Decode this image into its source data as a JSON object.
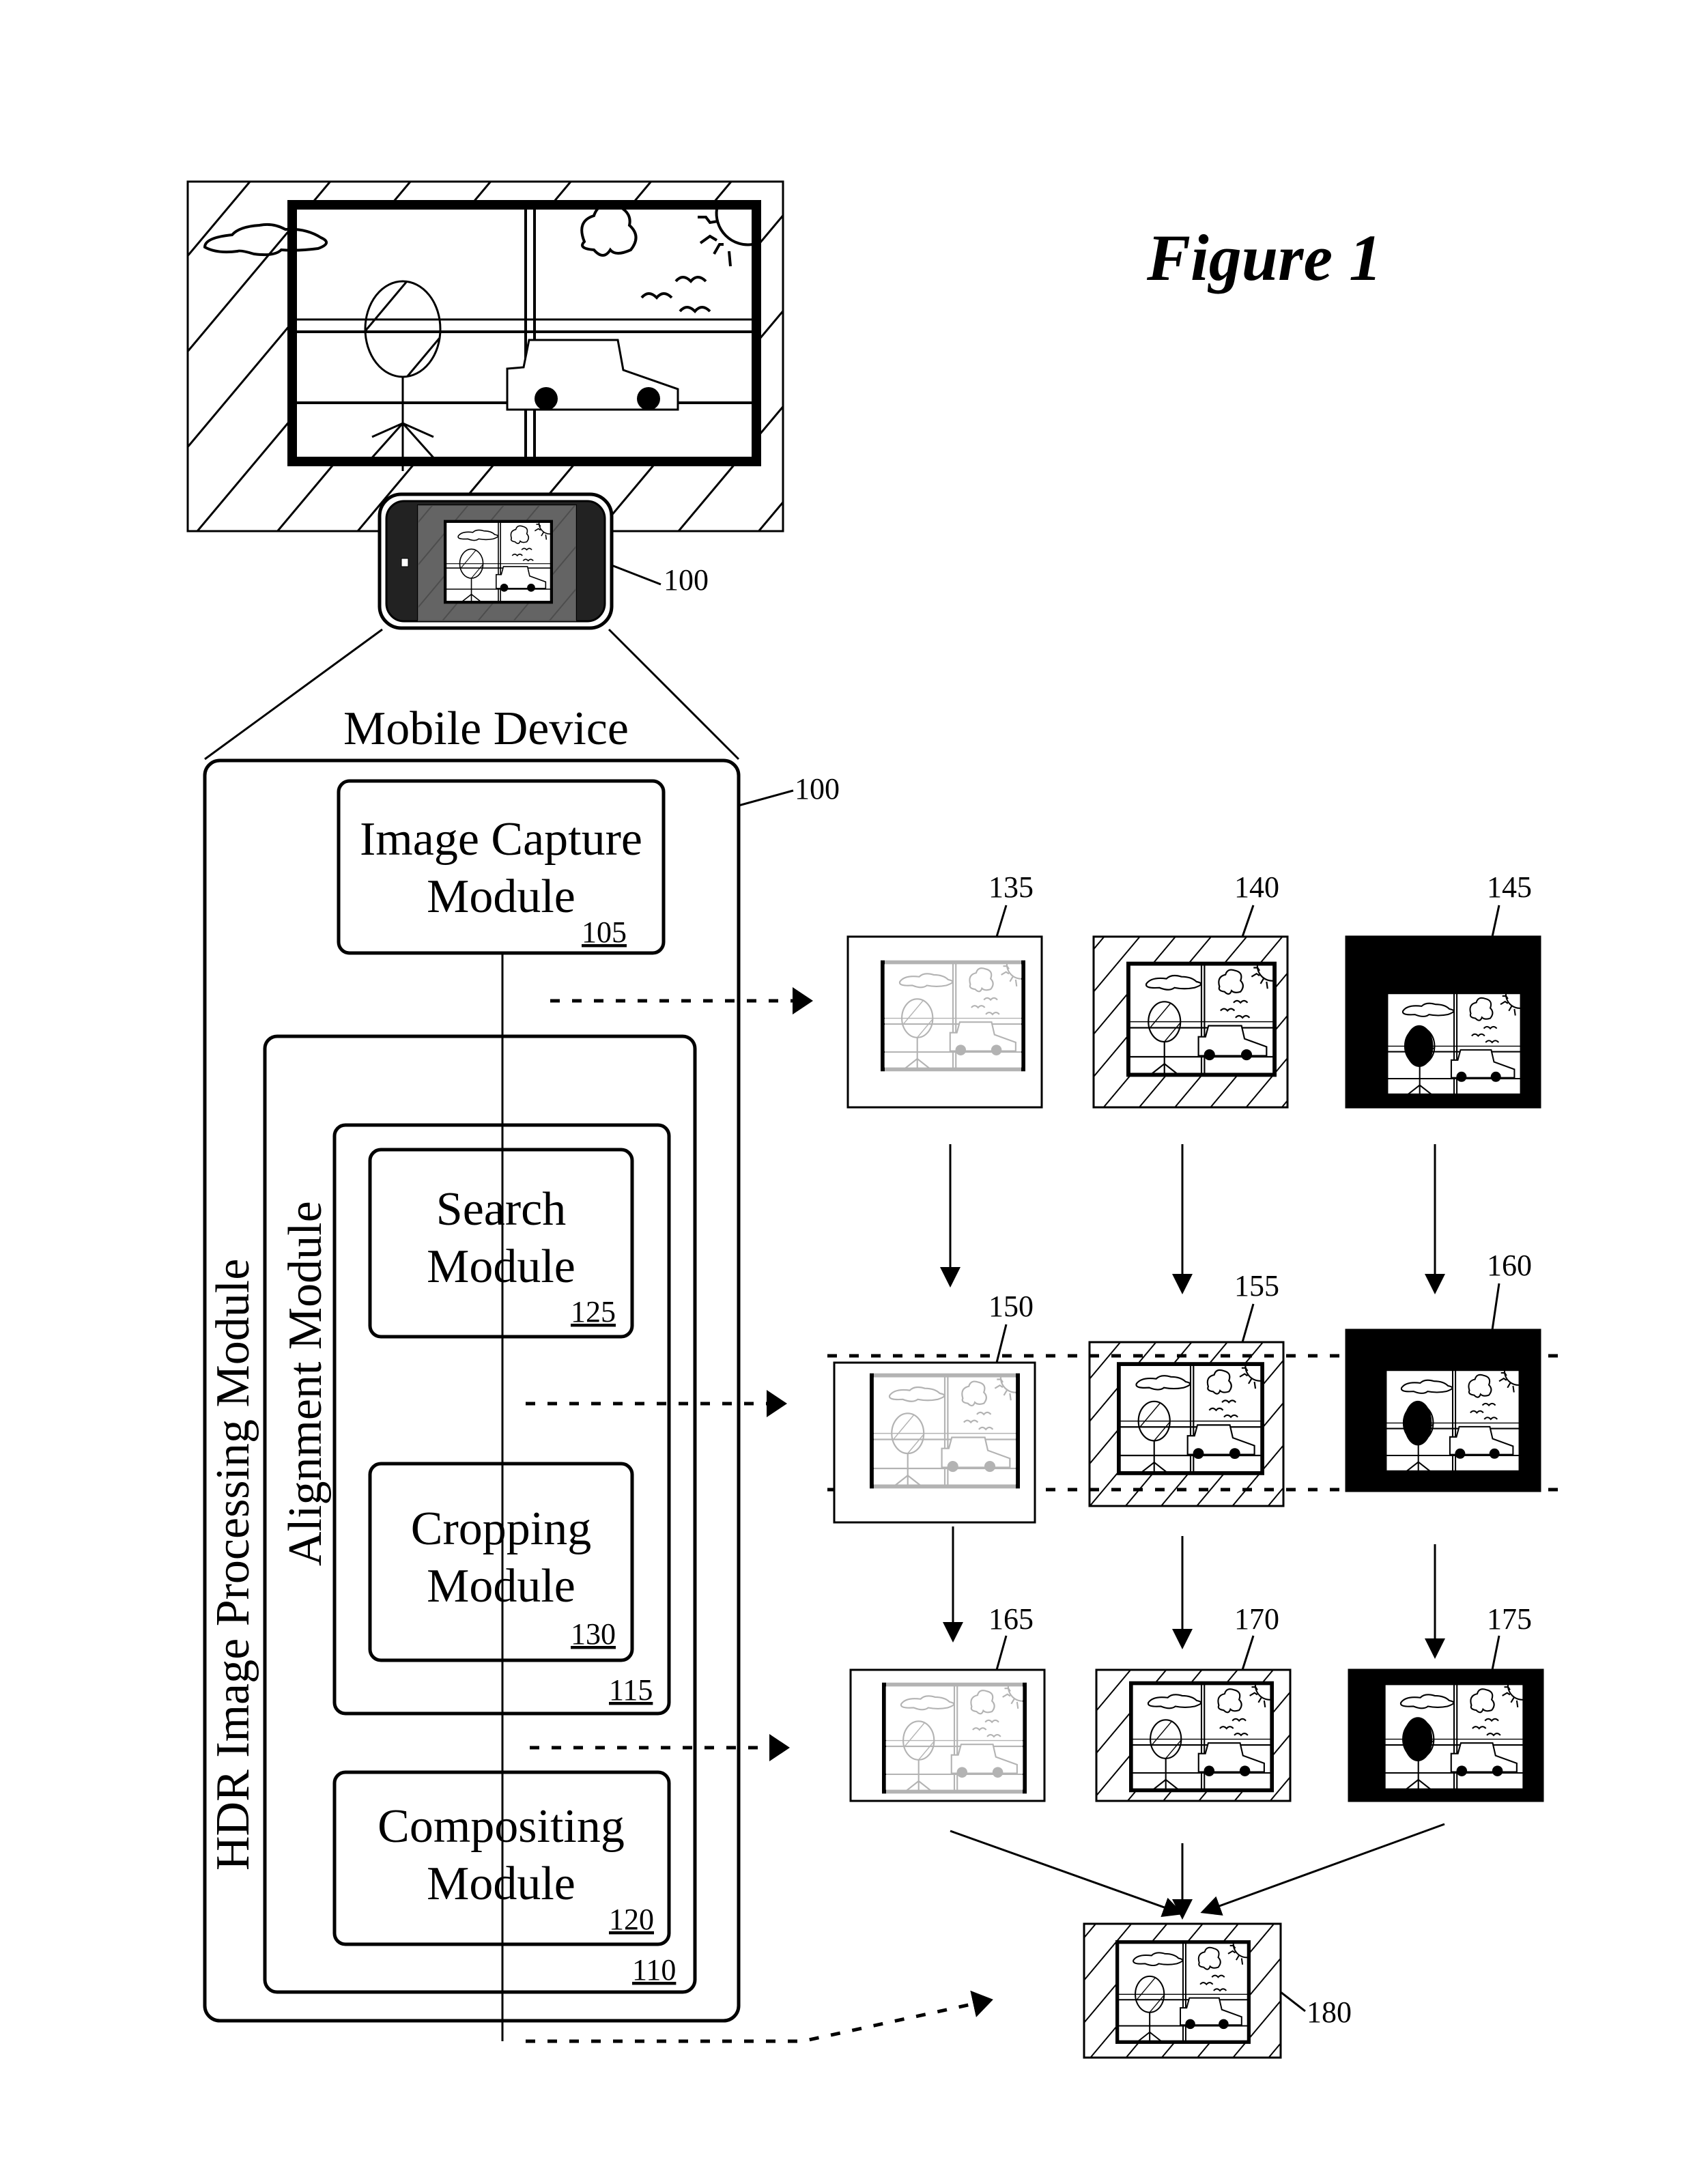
{
  "figure": {
    "title": "Figure 1",
    "scene": {
      "description": "scene: window with cloud, sun, birds, car, and stick figure balloon; hatched wall",
      "icons": [
        "cloud-icon",
        "sun-icon",
        "bird-icon",
        "car-icon",
        "stick-figure-icon",
        "balloon-icon"
      ]
    },
    "device_ref": "100",
    "device_box": {
      "label": "Mobile Device",
      "ref": "100"
    },
    "modules": {
      "image_capture": {
        "line1": "Image Capture",
        "line2": "Module",
        "ref": "105"
      },
      "hdr_processing": {
        "label": "HDR Image Processing Module",
        "ref": "110"
      },
      "alignment": {
        "label": "Alignment Module",
        "ref": "115"
      },
      "search": {
        "line1": "Search",
        "line2": "Module",
        "ref": "125"
      },
      "cropping": {
        "line1": "Cropping",
        "line2": "Module",
        "ref": "130"
      },
      "compositing": {
        "line1": "Compositing",
        "line2": "Module",
        "ref": "120"
      }
    },
    "captured_images": [
      {
        "ref": "135",
        "exposure": "overexposed"
      },
      {
        "ref": "140",
        "exposure": "normal"
      },
      {
        "ref": "145",
        "exposure": "underexposed"
      }
    ],
    "aligned_images": [
      {
        "ref": "150",
        "exposure": "overexposed"
      },
      {
        "ref": "155",
        "exposure": "normal"
      },
      {
        "ref": "160",
        "exposure": "underexposed"
      }
    ],
    "cropped_images": [
      {
        "ref": "165",
        "exposure": "overexposed"
      },
      {
        "ref": "170",
        "exposure": "normal"
      },
      {
        "ref": "175",
        "exposure": "underexposed"
      }
    ],
    "hdr_result": {
      "ref": "180"
    }
  }
}
